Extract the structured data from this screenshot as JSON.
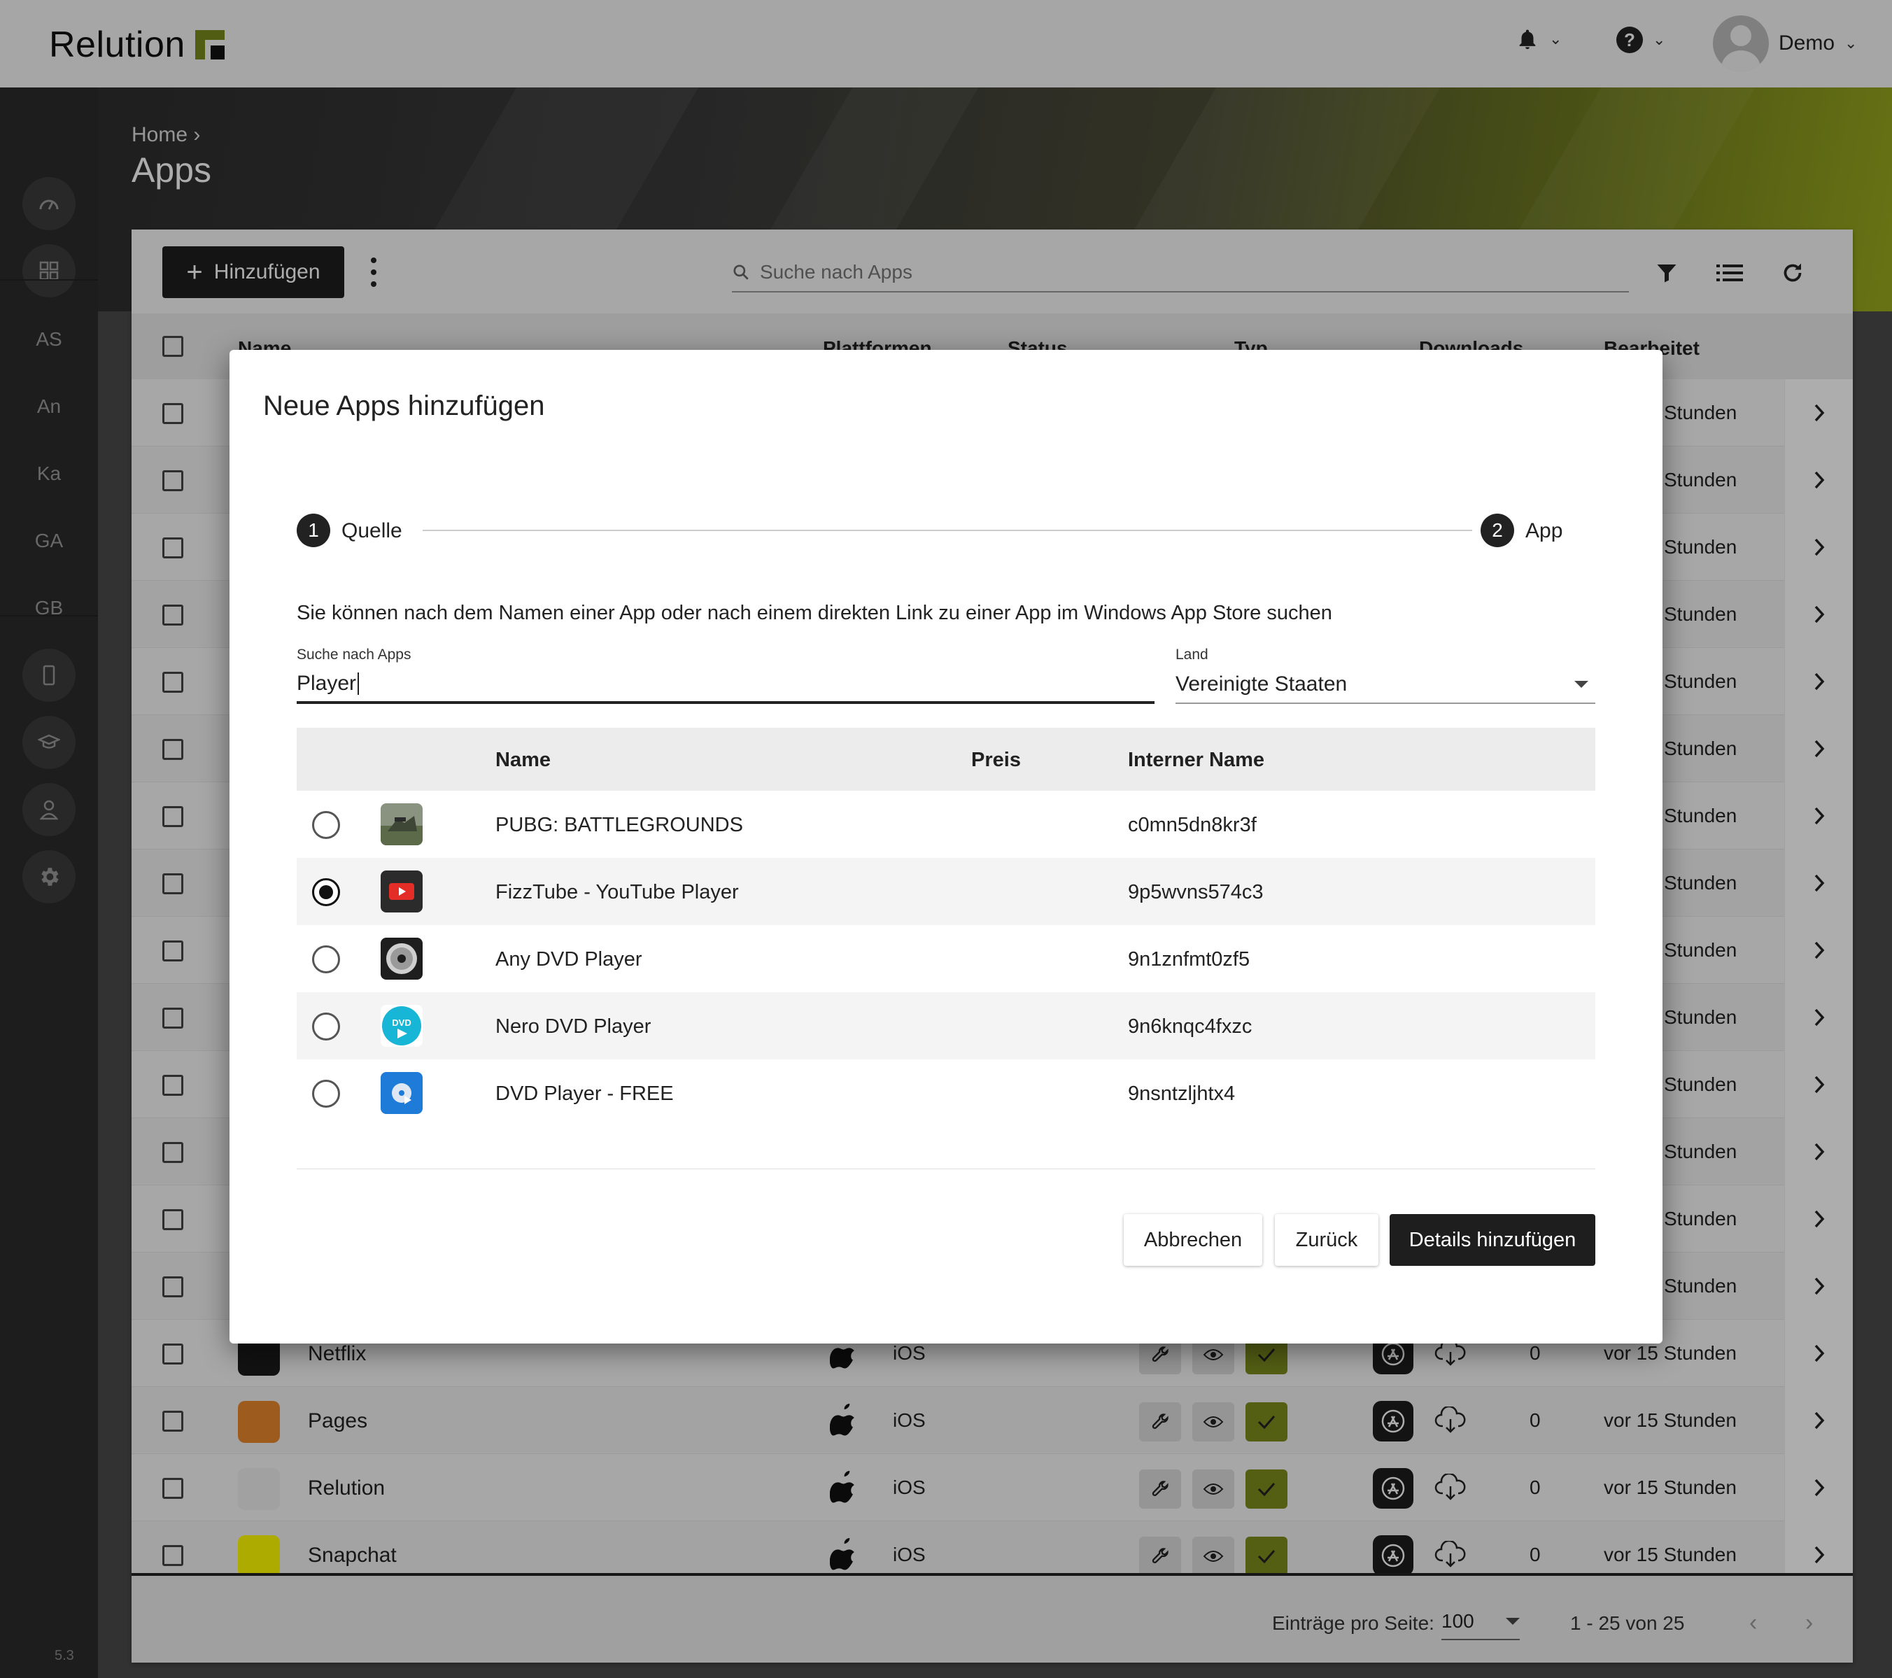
{
  "app": {
    "brand": "Relution",
    "user": "Demo",
    "version": "5.3"
  },
  "sidebar": {
    "items": [
      "AS",
      "An",
      "Ka",
      "GA",
      "GB"
    ]
  },
  "hero": {
    "breadcrumb": "Home",
    "breadcrumb_sep": "›",
    "title": "Apps"
  },
  "toolbar": {
    "add_label": "Hinzufügen",
    "search_placeholder": "Suche nach Apps"
  },
  "table": {
    "columns": [
      "Name",
      "Plattformen",
      "Status",
      "Typ",
      "Downloads",
      "Bearbeitet"
    ],
    "partial_edited": "Stunden",
    "rows": [
      {
        "name": "Netflix",
        "platform": "iOS",
        "downloads": "0",
        "edited": "vor 15 Stunden",
        "icon_color": "#1b1b1b"
      },
      {
        "name": "Pages",
        "platform": "iOS",
        "downloads": "0",
        "edited": "vor 15 Stunden",
        "icon_color": "#e8862d"
      },
      {
        "name": "Relution",
        "platform": "iOS",
        "downloads": "0",
        "edited": "vor 15 Stunden",
        "icon_color": "#eeeeee"
      },
      {
        "name": "Snapchat",
        "platform": "iOS",
        "downloads": "0",
        "edited": "vor 15 Stunden",
        "icon_color": "#fffc00"
      }
    ]
  },
  "footer": {
    "per_page_label": "Einträge pro Seite:",
    "per_page_value": "100",
    "range": "1 - 25 von 25"
  },
  "modal": {
    "title": "Neue Apps hinzufügen",
    "steps": [
      {
        "num": "1",
        "label": "Quelle"
      },
      {
        "num": "2",
        "label": "App"
      }
    ],
    "hint": "Sie können nach dem Namen einer App oder nach einem direkten Link zu einer App im Windows App Store suchen",
    "search_label": "Suche nach Apps",
    "search_value": "Player",
    "country_label": "Land",
    "country_value": "Vereinigte Staaten",
    "columns": {
      "name": "Name",
      "price": "Preis",
      "internal": "Interner Name"
    },
    "results": [
      {
        "name": "PUBG: BATTLEGROUNDS",
        "price": "",
        "internal": "c0mn5dn8kr3f",
        "selected": false,
        "icon": "pubg-icon"
      },
      {
        "name": "FizzTube - YouTube Player",
        "price": "",
        "internal": "9p5wvns574c3",
        "selected": true,
        "icon": "fizztube-icon"
      },
      {
        "name": "Any DVD Player",
        "price": "",
        "internal": "9n1znfmt0zf5",
        "selected": false,
        "icon": "any-dvd-icon"
      },
      {
        "name": "Nero DVD Player",
        "price": "",
        "internal": "9n6knqc4fxzc",
        "selected": false,
        "icon": "nero-dvd-icon"
      },
      {
        "name": "DVD Player - FREE",
        "price": "",
        "internal": "9nsntzljhtx4",
        "selected": false,
        "icon": "dvd-free-icon"
      }
    ],
    "buttons": {
      "cancel": "Abbrechen",
      "back": "Zurück",
      "next": "Details hinzufügen"
    }
  },
  "colors": {
    "accent": "#7a8a1e",
    "status_green": "#7d8c1e",
    "dark": "#1e1e1e"
  }
}
